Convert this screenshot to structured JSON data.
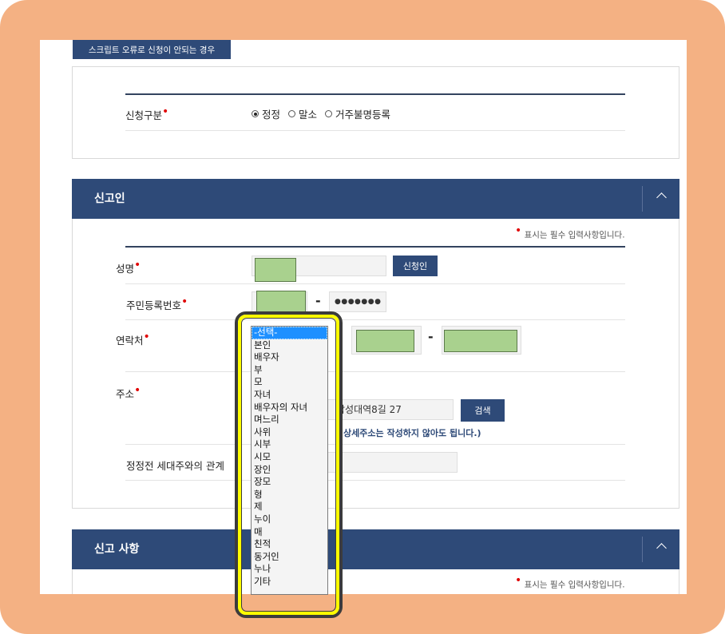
{
  "script_error_button": "스크립트 오류로 신청이 안되는 경우",
  "request_type": {
    "label": "신청구분",
    "options": [
      {
        "label": "정정",
        "checked": true
      },
      {
        "label": "말소",
        "checked": false
      },
      {
        "label": "거주불명등록",
        "checked": false
      }
    ]
  },
  "reporter_section": {
    "title": "신고인",
    "required_note": "표시는 필수 입력사항입니다.",
    "name_label": "성명",
    "applicant_button": "신청인",
    "rrn_label": "주민등록번호",
    "rrn_dash": "-",
    "rrn_back": "●●●●●●●",
    "contact_label": "연락처",
    "contact_dash": "-",
    "address_label": "주소",
    "address_value": "삼성대역8길 27",
    "search_button": "검색",
    "address_note": "(상세주소는 작성하지 않아도 됩니다.)",
    "relation_label": "정정전 세대주와의 관계"
  },
  "report_section": {
    "title": "신고 사항",
    "required_note": "표시는 필수 입력사항입니다."
  },
  "relation_dropdown": {
    "options": [
      "-선택-",
      "본인",
      "배우자",
      "부",
      "모",
      "자녀",
      "배우자의 자녀",
      "며느리",
      "사위",
      "시부",
      "시모",
      "장인",
      "장모",
      "형",
      "제",
      "누이",
      "매",
      "친적",
      "동거인",
      "누나",
      "기타"
    ],
    "selected_index": 0
  },
  "colors": {
    "header_navy": "#2e4a78",
    "frame_orange": "#f4b183",
    "highlight_yellow": "#ffff00",
    "masked_green": "#a9d18e",
    "required_red": "#e00000"
  }
}
